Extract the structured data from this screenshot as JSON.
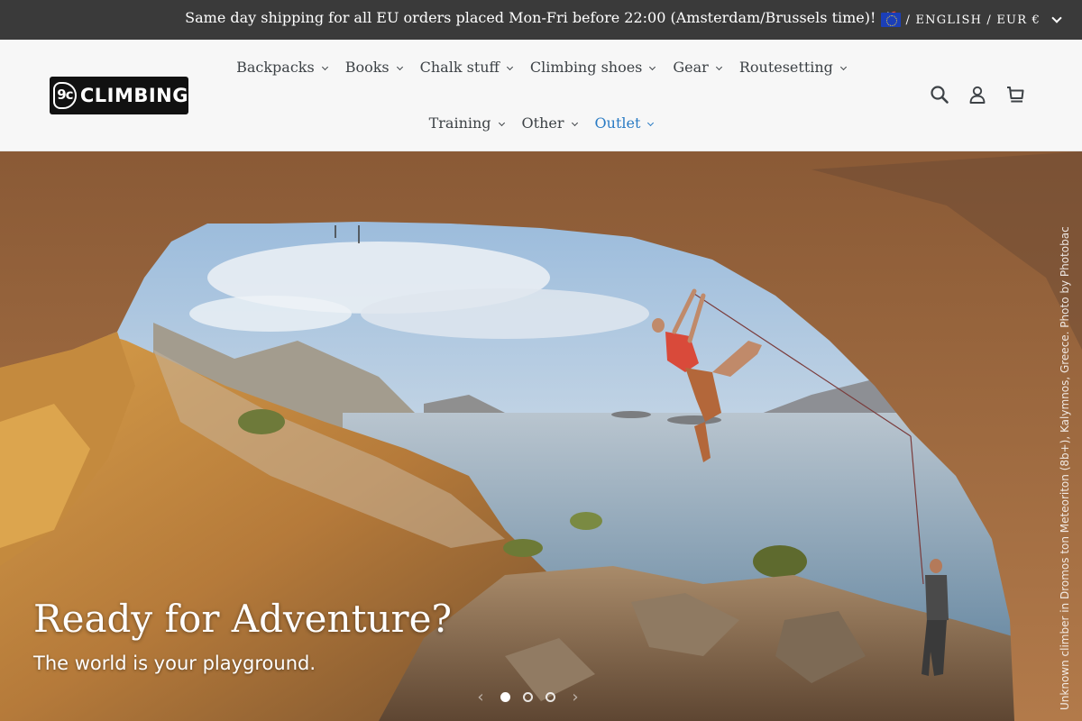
{
  "announcement": {
    "text": "Same day shipping for all EU orders placed Mon-Fri before 22:00 (Amsterdam/Brussels time)!",
    "emoji": "🚀"
  },
  "locale": {
    "flag_icon": "eu-flag-icon",
    "label": "/ ENGLISH / EUR €"
  },
  "logo": {
    "badge": "9c",
    "word": "CLIMBING"
  },
  "nav": {
    "items": [
      {
        "label": "Backpacks"
      },
      {
        "label": "Books"
      },
      {
        "label": "Chalk stuff"
      },
      {
        "label": "Climbing shoes"
      },
      {
        "label": "Gear"
      },
      {
        "label": "Routesetting"
      },
      {
        "label": "Training"
      },
      {
        "label": "Other"
      },
      {
        "label": "Outlet"
      }
    ],
    "active_color": "#2a7bc4"
  },
  "header_icons": [
    "search-icon",
    "account-icon",
    "cart-icon"
  ],
  "hero": {
    "title": "Ready for Adventure?",
    "subtitle": "The world is your playground.",
    "credit": "Unknown climber in Dromos ton Meteoriton (8b+), Kalymnos, Greece. Photo by Photobac",
    "slides_count": 3,
    "active_slide": 1,
    "prev_arrow": "‹",
    "next_arrow": "›"
  }
}
